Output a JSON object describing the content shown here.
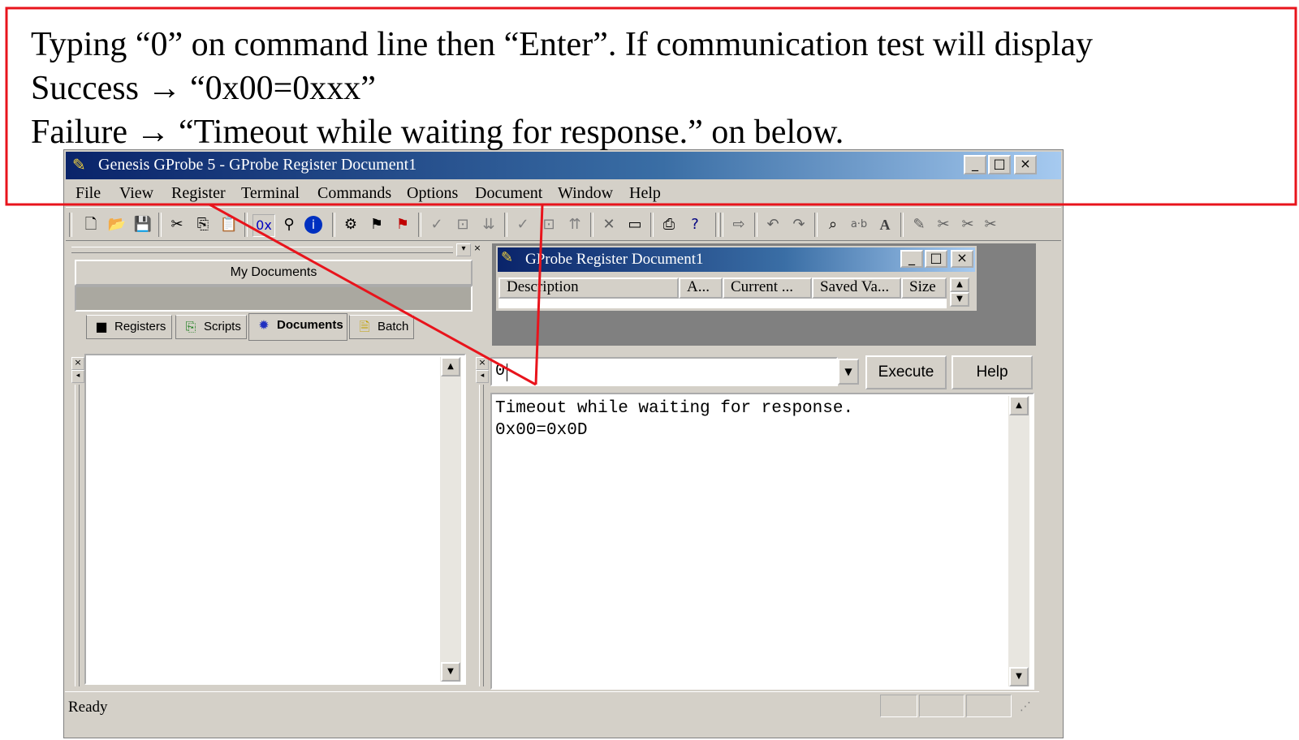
{
  "annotation": {
    "line1": "Typing “0” on command line then “Enter”. If communication test will display",
    "line2": "Success → “0x00=0xxx”",
    "line3": "Failure → “Timeout while waiting for response.”    on below.",
    "box_color": "#e8141c"
  },
  "window": {
    "title": "Genesis GProbe 5 - GProbe Register Document1",
    "controls": {
      "minimize": "_",
      "maximize": "□",
      "close": "×"
    }
  },
  "menu": [
    "File",
    "View",
    "Register",
    "Terminal",
    "Commands",
    "Options",
    "Document",
    "Window",
    "Help"
  ],
  "toolbar_icons": [
    "new-icon",
    "open-icon",
    "save-icon",
    "cut-icon",
    "copy-icon",
    "paste-icon",
    "hex-icon",
    "find-icon",
    "info-icon",
    "probe-icon",
    "flag-icon",
    "stop-icon",
    "check-down-icon",
    "reg-down-icon",
    "arrows-down-icon",
    "check-icon",
    "reg-up-icon",
    "arrows-up-icon",
    "delete-icon",
    "window-icon",
    "print-icon",
    "help-icon",
    "export-icon",
    "undo-icon",
    "redo-icon",
    "binoculars-icon",
    "ab-icon",
    "font-icon",
    "tool1-icon",
    "tool2-icon",
    "tool3-icon",
    "tool4-icon"
  ],
  "left_panel": {
    "header": "My Documents",
    "tabs": [
      "Registers",
      "Scripts",
      "Documents",
      "Batch"
    ],
    "active_tab": "Documents"
  },
  "doc_window": {
    "title": "GProbe Register Document1",
    "columns": [
      "Description",
      "A...",
      "Current ...",
      "Saved Va...",
      "Size"
    ]
  },
  "command": {
    "input_value": "0",
    "execute_label": "Execute",
    "help_label": "Help"
  },
  "output": {
    "line1": "Timeout while waiting for response.",
    "line2": "0x00=0x0D"
  },
  "status": {
    "text": "Ready"
  }
}
